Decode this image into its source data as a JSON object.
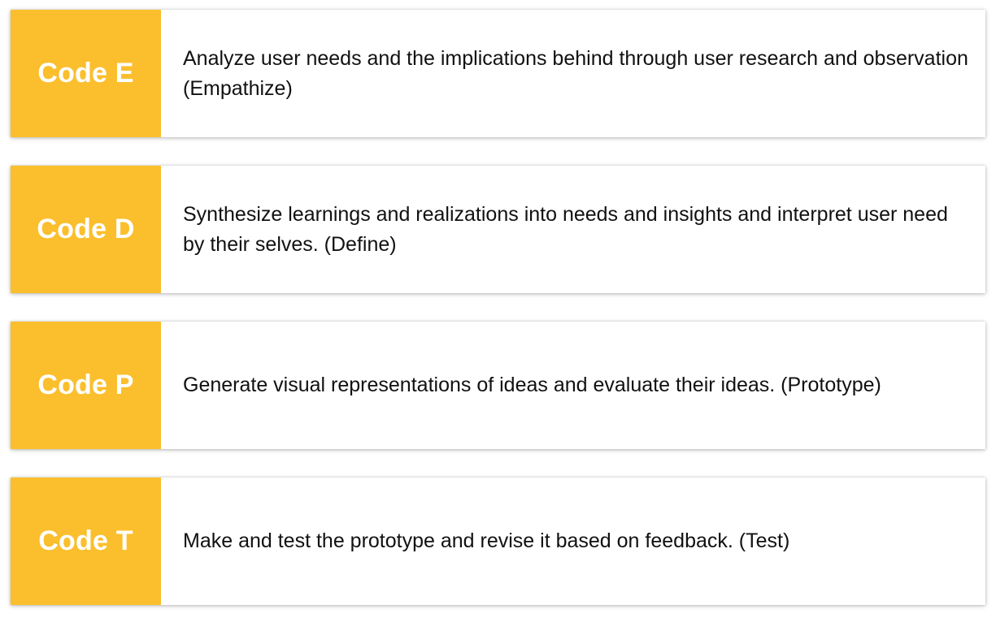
{
  "colors": {
    "code_background": "#fbbf2d",
    "code_text": "#ffffff",
    "description_text": "#111111",
    "card_background": "#ffffff"
  },
  "cards": [
    {
      "code": "Code E",
      "description": "Analyze user needs and the implications behind through user research and observation (Empathize)"
    },
    {
      "code": "Code D",
      "description": "Synthesize learnings and realizations into needs and insights and interpret user need by their selves. (Define)"
    },
    {
      "code": "Code P",
      "description": "Generate visual representations of ideas and evaluate their ideas. (Prototype)"
    },
    {
      "code": "Code T",
      "description": "Make and test the prototype and revise it based on feedback. (Test)"
    }
  ]
}
